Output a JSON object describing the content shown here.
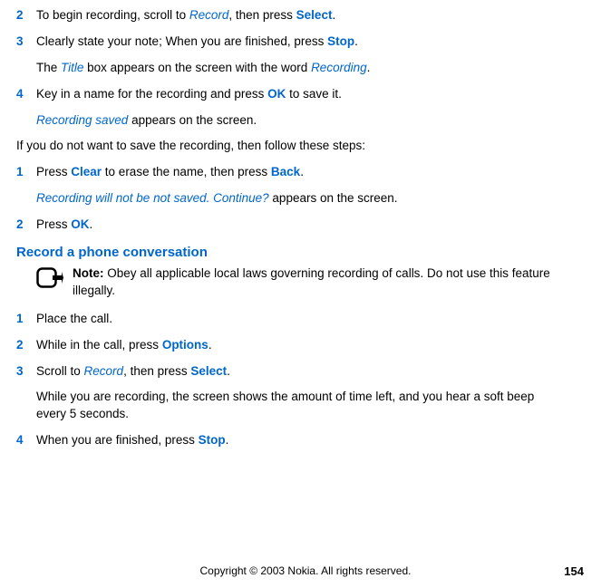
{
  "stepsA": [
    {
      "num": "2",
      "parts": [
        {
          "t": "To begin recording, scroll to "
        },
        {
          "t": "Record",
          "cls": "italic-blue"
        },
        {
          "t": ", then press "
        },
        {
          "t": "Select",
          "cls": "bold-blue"
        },
        {
          "t": "."
        }
      ]
    },
    {
      "num": "3",
      "parts": [
        {
          "t": "Clearly state your note; When you are finished, press "
        },
        {
          "t": "Stop",
          "cls": "bold-blue"
        },
        {
          "t": "."
        }
      ]
    }
  ],
  "after3": {
    "parts": [
      {
        "t": "The "
      },
      {
        "t": "Title",
        "cls": "italic-blue"
      },
      {
        "t": " box appears on the screen with the word "
      },
      {
        "t": "Recording",
        "cls": "italic-blue"
      },
      {
        "t": "."
      }
    ]
  },
  "step4": {
    "num": "4",
    "parts": [
      {
        "t": "Key in a name for the recording and press "
      },
      {
        "t": "OK",
        "cls": "bold-blue"
      },
      {
        "t": " to save it."
      }
    ]
  },
  "after4": {
    "parts": [
      {
        "t": "Recording saved",
        "cls": "italic-blue"
      },
      {
        "t": " appears on the screen."
      }
    ]
  },
  "plain1": "If you do not want to save the recording, then follow these steps:",
  "stepsB": [
    {
      "num": "1",
      "parts": [
        {
          "t": "Press "
        },
        {
          "t": "Clear",
          "cls": "bold-blue"
        },
        {
          "t": " to erase the name, then press "
        },
        {
          "t": "Back",
          "cls": "bold-blue"
        },
        {
          "t": "."
        }
      ]
    }
  ],
  "afterB1": {
    "parts": [
      {
        "t": "Recording will not be not saved. Continue?",
        "cls": "italic-blue"
      },
      {
        "t": " appears on the screen."
      }
    ]
  },
  "stepB2": {
    "num": "2",
    "parts": [
      {
        "t": "Press "
      },
      {
        "t": "OK",
        "cls": "bold-blue"
      },
      {
        "t": "."
      }
    ]
  },
  "sectionTitle": "Record a phone conversation",
  "noteLabel": "Note:",
  "noteBody": " Obey all applicable local laws governing recording of calls. Do not use this feature illegally.",
  "stepsC": [
    {
      "num": "1",
      "parts": [
        {
          "t": "Place the call."
        }
      ]
    },
    {
      "num": "2",
      "parts": [
        {
          "t": "While in the call, press "
        },
        {
          "t": "Options",
          "cls": "bold-blue"
        },
        {
          "t": "."
        }
      ]
    },
    {
      "num": "3",
      "parts": [
        {
          "t": "Scroll to "
        },
        {
          "t": "Record",
          "cls": "italic-blue"
        },
        {
          "t": ", then press "
        },
        {
          "t": "Select",
          "cls": "bold-blue"
        },
        {
          "t": "."
        }
      ]
    }
  ],
  "afterC3": "While you are recording, the screen shows the amount of time left, and you hear a soft beep every 5 seconds.",
  "stepC4": {
    "num": "4",
    "parts": [
      {
        "t": "When you are finished, press "
      },
      {
        "t": "Stop",
        "cls": "bold-blue"
      },
      {
        "t": "."
      }
    ]
  },
  "copyright": "Copyright © 2003 Nokia. All rights reserved.",
  "pageNum": "154"
}
